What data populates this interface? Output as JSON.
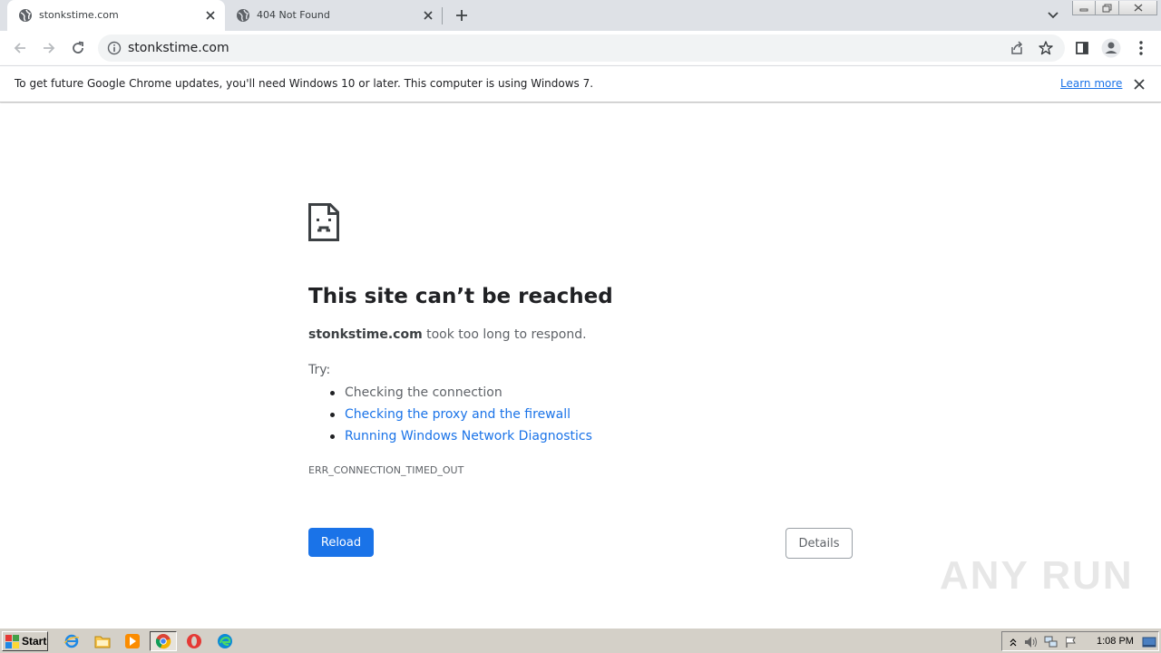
{
  "tabs": [
    {
      "title": "stonkstime.com",
      "active": true
    },
    {
      "title": "404 Not Found",
      "active": false
    }
  ],
  "omnibox": {
    "url": "stonkstime.com"
  },
  "infobar": {
    "message": "To get future Google Chrome updates, you'll need Windows 10 or later. This computer is using Windows 7.",
    "link": "Learn more"
  },
  "error": {
    "headline": "This site can’t be reached",
    "host": "stonkstime.com",
    "summary_rest": " took too long to respond.",
    "try_label": "Try:",
    "suggestions": [
      {
        "text": "Checking the connection",
        "link": false
      },
      {
        "text": "Checking the proxy and the firewall",
        "link": true
      },
      {
        "text": "Running Windows Network Diagnostics",
        "link": true
      }
    ],
    "code": "ERR_CONNECTION_TIMED_OUT",
    "reload_label": "Reload",
    "details_label": "Details"
  },
  "watermark": "ANY RUN",
  "taskbar": {
    "start_label": "Start",
    "clock": "1:08 PM"
  },
  "colors": {
    "accent": "#1a73e8",
    "tabstrip": "#dee1e6",
    "taskbar": "#d4d0c8"
  }
}
